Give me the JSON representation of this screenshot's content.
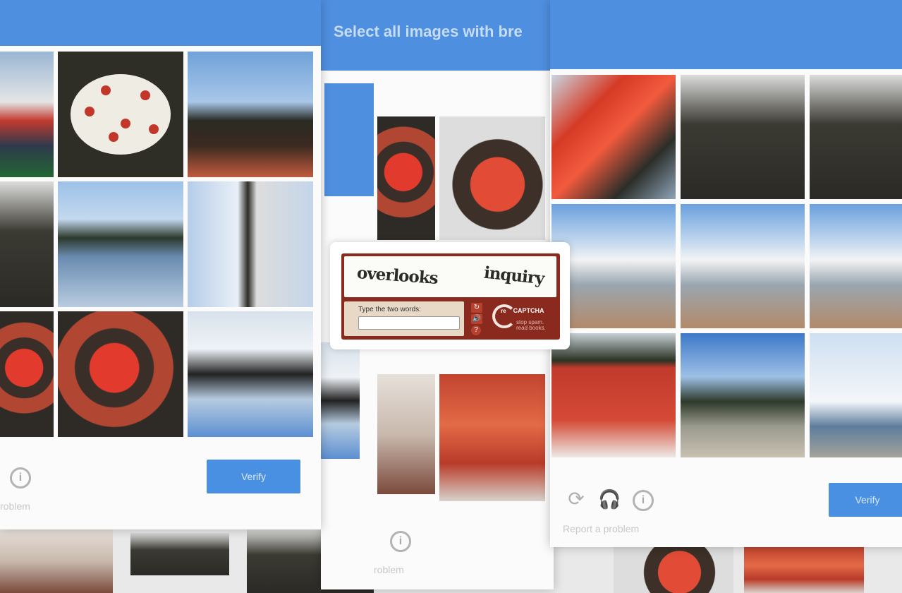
{
  "left_dialog": {
    "verify_label": "Verify",
    "report_label": "roblem",
    "info_icon": "info-circle-icon"
  },
  "middle_dialog": {
    "title": "Select all images with bre",
    "report_label": "roblem",
    "info_icon": "info-circle-icon"
  },
  "right_dialog": {
    "verify_label": "Verify",
    "report_label": "Report a problem",
    "icons": [
      "reload-icon",
      "headphones-icon",
      "info-circle-icon"
    ]
  },
  "recaptcha_v1": {
    "word_1": "overlooks",
    "word_2": "inquiry",
    "input_label": "Type the two words:",
    "input_value": "",
    "tools": [
      "refresh-icon",
      "audio-icon",
      "help-icon"
    ],
    "brand_re": "re",
    "brand_name": "CAPTCHA",
    "tagline": "stop spam. read books.",
    "colors": {
      "frame": "#8a2a1e",
      "header_blue": "#4f8fe0",
      "verify_blue": "#4a90e2"
    }
  }
}
